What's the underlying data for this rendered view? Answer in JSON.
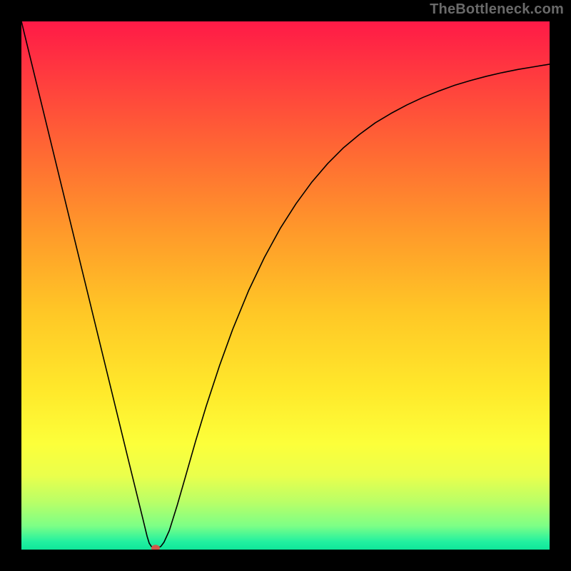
{
  "watermark": "TheBottleneck.com",
  "chart_data": {
    "type": "line",
    "title": "",
    "xlabel": "",
    "ylabel": "",
    "x_range": [
      0,
      100
    ],
    "y_range": [
      0,
      100
    ],
    "grid": false,
    "legend": false,
    "background": {
      "type": "vertical-gradient",
      "stops": [
        {
          "offset": 0.0,
          "color": "#ff1a47"
        },
        {
          "offset": 0.1,
          "color": "#ff3a3f"
        },
        {
          "offset": 0.25,
          "color": "#ff6a33"
        },
        {
          "offset": 0.4,
          "color": "#ff9a2a"
        },
        {
          "offset": 0.55,
          "color": "#ffc726"
        },
        {
          "offset": 0.7,
          "color": "#ffe92b"
        },
        {
          "offset": 0.8,
          "color": "#fcff3a"
        },
        {
          "offset": 0.86,
          "color": "#eaff4c"
        },
        {
          "offset": 0.91,
          "color": "#b9ff67"
        },
        {
          "offset": 0.955,
          "color": "#7dff86"
        },
        {
          "offset": 0.985,
          "color": "#22f0a0"
        },
        {
          "offset": 1.0,
          "color": "#0fe69a"
        }
      ]
    },
    "series": [
      {
        "name": "bottleneck-curve",
        "color": "#000000",
        "stroke_width": 1.6,
        "data": [
          {
            "x": 0.0,
            "y": 100.0
          },
          {
            "x": 2.0,
            "y": 91.8
          },
          {
            "x": 4.0,
            "y": 83.6
          },
          {
            "x": 6.0,
            "y": 75.4
          },
          {
            "x": 8.0,
            "y": 67.2
          },
          {
            "x": 10.0,
            "y": 59.0
          },
          {
            "x": 12.0,
            "y": 50.8
          },
          {
            "x": 14.0,
            "y": 42.6
          },
          {
            "x": 16.0,
            "y": 34.4
          },
          {
            "x": 18.0,
            "y": 26.2
          },
          {
            "x": 20.0,
            "y": 18.0
          },
          {
            "x": 21.5,
            "y": 11.9
          },
          {
            "x": 23.0,
            "y": 5.8
          },
          {
            "x": 23.8,
            "y": 2.5
          },
          {
            "x": 24.2,
            "y": 1.2
          },
          {
            "x": 24.6,
            "y": 0.6
          },
          {
            "x": 25.1,
            "y": 0.3
          },
          {
            "x": 25.8,
            "y": 0.3
          },
          {
            "x": 26.4,
            "y": 0.6
          },
          {
            "x": 27.0,
            "y": 1.4
          },
          {
            "x": 28.0,
            "y": 3.6
          },
          {
            "x": 29.5,
            "y": 8.4
          },
          {
            "x": 31.0,
            "y": 13.6
          },
          {
            "x": 33.0,
            "y": 20.6
          },
          {
            "x": 35.0,
            "y": 27.2
          },
          {
            "x": 37.5,
            "y": 34.8
          },
          {
            "x": 40.0,
            "y": 41.7
          },
          {
            "x": 43.0,
            "y": 49.0
          },
          {
            "x": 46.0,
            "y": 55.3
          },
          {
            "x": 49.0,
            "y": 60.8
          },
          {
            "x": 52.0,
            "y": 65.5
          },
          {
            "x": 55.0,
            "y": 69.6
          },
          {
            "x": 58.0,
            "y": 73.1
          },
          {
            "x": 61.0,
            "y": 76.1
          },
          {
            "x": 64.0,
            "y": 78.6
          },
          {
            "x": 67.0,
            "y": 80.8
          },
          {
            "x": 70.0,
            "y": 82.6
          },
          {
            "x": 73.0,
            "y": 84.2
          },
          {
            "x": 76.0,
            "y": 85.6
          },
          {
            "x": 79.0,
            "y": 86.8
          },
          {
            "x": 82.0,
            "y": 87.9
          },
          {
            "x": 85.0,
            "y": 88.8
          },
          {
            "x": 88.0,
            "y": 89.6
          },
          {
            "x": 91.0,
            "y": 90.3
          },
          {
            "x": 94.0,
            "y": 90.9
          },
          {
            "x": 97.0,
            "y": 91.4
          },
          {
            "x": 100.0,
            "y": 91.9
          }
        ]
      }
    ],
    "marker": {
      "name": "optimal-point",
      "x": 25.4,
      "y": 0.3,
      "rx": 6,
      "ry": 4.5,
      "color": "#d05a4a"
    }
  }
}
